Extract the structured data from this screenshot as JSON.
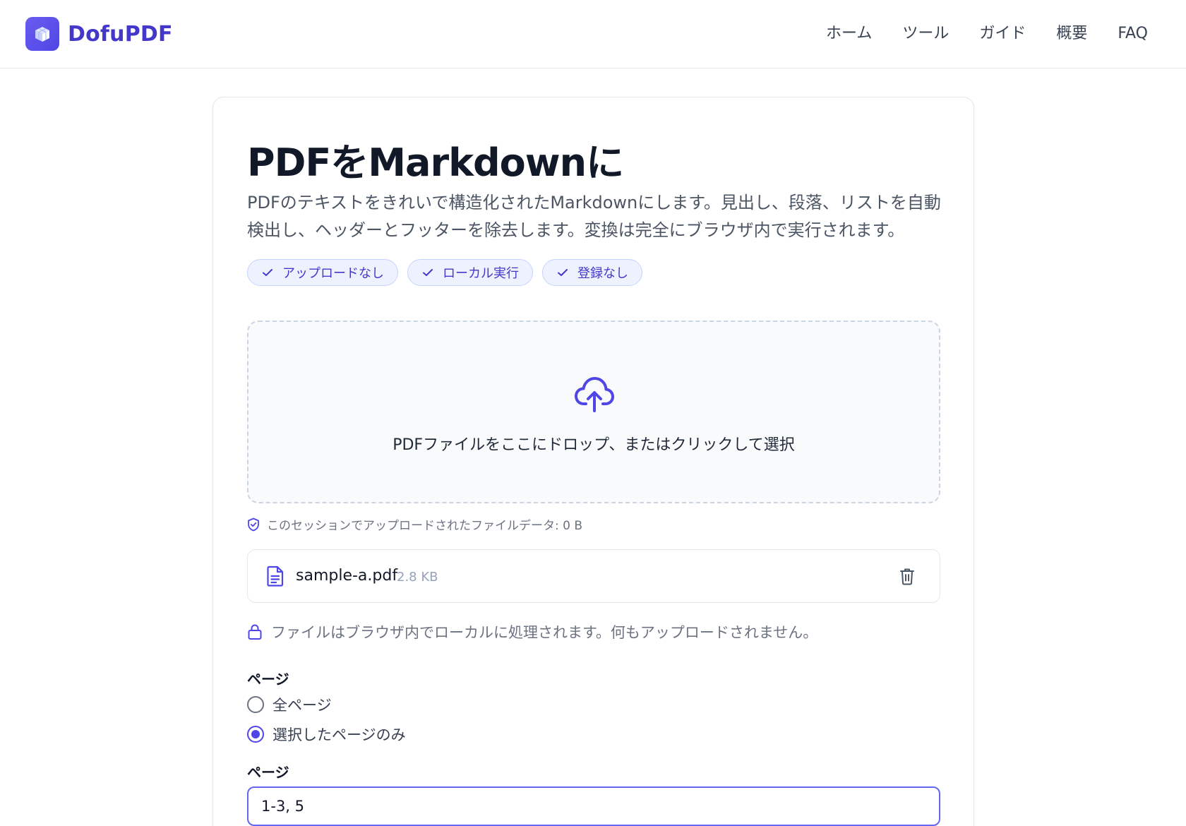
{
  "header": {
    "brand_name": "DofuPDF",
    "logo_icon": "cube-icon",
    "nav": [
      {
        "label": "ホーム"
      },
      {
        "label": "ツール"
      },
      {
        "label": "ガイド"
      },
      {
        "label": "概要"
      },
      {
        "label": "FAQ"
      }
    ]
  },
  "main": {
    "title": "PDFをMarkdownに",
    "description": "PDFのテキストをきれいで構造化されたMarkdownにします。見出し、段落、リストを自動検出し、ヘッダーとフッターを除去します。変換は完全にブラウザ内で実行されます。",
    "chips": [
      {
        "label": "アップロードなし",
        "icon": "check-icon"
      },
      {
        "label": "ローカル実行",
        "icon": "check-icon"
      },
      {
        "label": "登録なし",
        "icon": "check-icon"
      }
    ],
    "dropzone": {
      "icon": "cloud-upload-icon",
      "text": "PDFファイルをここにドロップ、またはクリックして選択"
    },
    "session_note": "このセッションでアップロードされたファイルデータ: 0 B",
    "file": {
      "name": "sample-a.pdf",
      "size": "2.8 KB"
    },
    "privacy_note": "ファイルはブラウザ内でローカルに処理されます。何もアップロードされません。",
    "page_mode": {
      "label": "ページ",
      "options": [
        {
          "label": "全ページ",
          "selected": false
        },
        {
          "label": "選択したページのみ",
          "selected": true
        }
      ]
    },
    "pages_field": {
      "label": "ページ",
      "value": "1-3, 5"
    }
  },
  "colors": {
    "accent": "#4f46e5",
    "brand_text": "#4338ca",
    "chip_bg": "#eef2ff"
  }
}
